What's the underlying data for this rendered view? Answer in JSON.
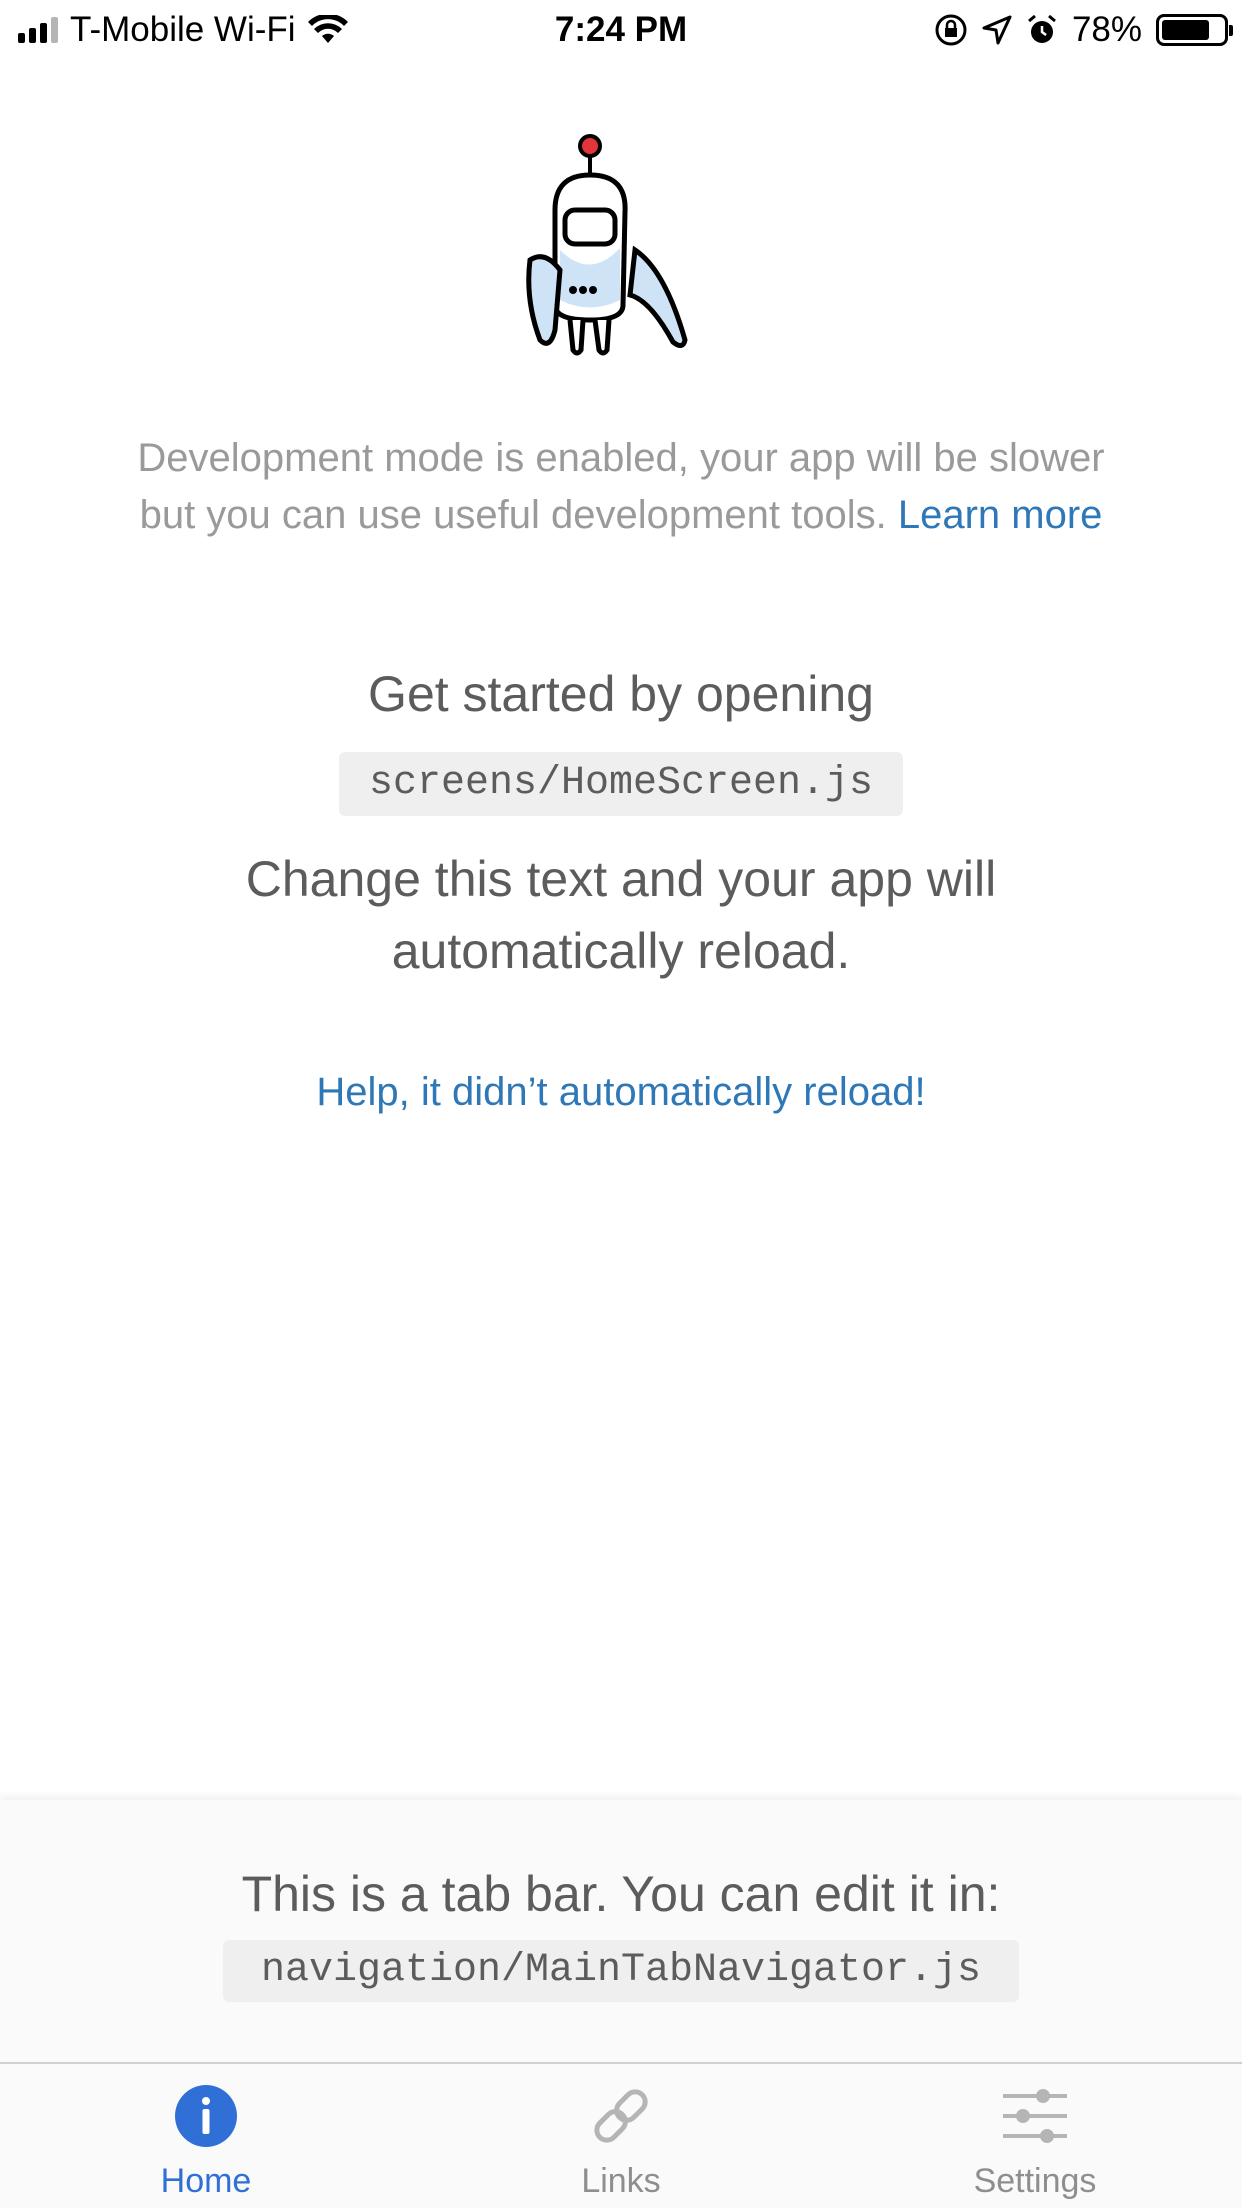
{
  "status_bar": {
    "carrier": "T-Mobile Wi-Fi",
    "time": "7:24 PM",
    "battery_percent": "78%",
    "battery_level": 0.78,
    "icons": [
      "signal-icon",
      "wifi-icon",
      "orientation-lock-icon",
      "location-icon",
      "alarm-icon",
      "battery-icon"
    ]
  },
  "main": {
    "robot_image": "robot-icon",
    "dev_mode_text": "Development mode is enabled, your app will be slower but you can use useful development tools.",
    "learn_more_link": "Learn more",
    "get_started_text": "Get started by opening",
    "code_path": "screens/HomeScreen.js",
    "change_text": "Change this text and your app will automatically reload.",
    "help_link": "Help, it didn’t automatically reload!"
  },
  "info_panel": {
    "text": "This is a tab bar. You can edit it in:",
    "code_path": "navigation/MainTabNavigator.js"
  },
  "tab_bar": {
    "active_color": "#2f6fd6",
    "inactive_color": "#8e8e8e",
    "tabs": [
      {
        "label": "Home",
        "icon": "info-icon",
        "active": true
      },
      {
        "label": "Links",
        "icon": "link-icon",
        "active": false
      },
      {
        "label": "Settings",
        "icon": "sliders-icon",
        "active": false
      }
    ]
  },
  "colors": {
    "link": "#2e78b7",
    "muted_text": "#9a9a9a",
    "body_text": "#5c5c5c",
    "code_background": "#efefef"
  }
}
